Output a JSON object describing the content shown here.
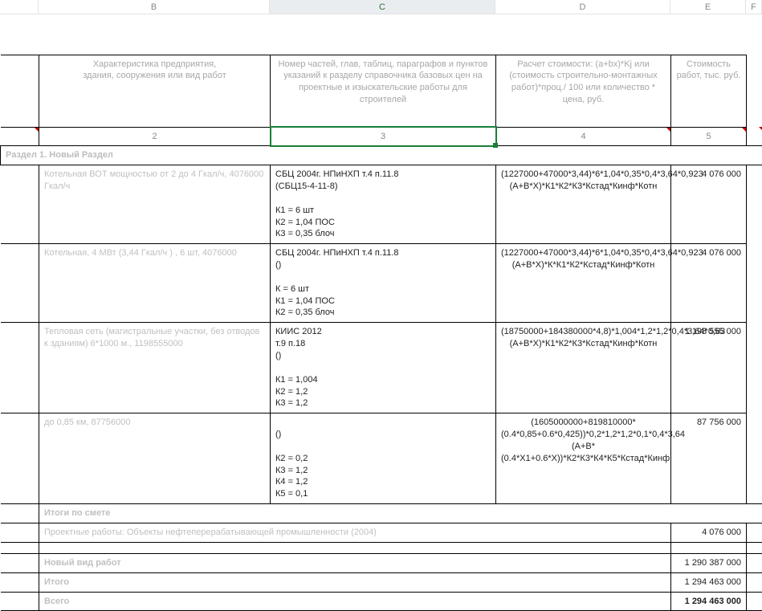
{
  "columns": {
    "A": "",
    "B": "B",
    "C": "C",
    "D": "D",
    "E": "E",
    "F": "F"
  },
  "header": {
    "B": "Характеристика предприятия,\nздания, сооружения или вид работ",
    "C": "Номер частей, глав, таблиц, параграфов и пунктов указаний к разделу справочника базовых цен на проектные и изыскательские работы для строителей",
    "D": "Расчет стоимости: (a+bx)*Kj или (стоимость строительно-монтажных работ)*проц./ 100 или количество * цена, руб.",
    "E": "Стоимость работ,   тыс. руб."
  },
  "numrow": {
    "B": "2",
    "C": "3",
    "D": "4",
    "E": "5"
  },
  "section": "Раздел 1. Новый Раздел",
  "rows": [
    {
      "B": "Котельная ВОТ мощностью от 2 до 4 Гкал/ч, 4076000 Гкал/ч",
      "C": "СБЦ 2004г. НПиНХП т.4 п.11.8\n(СБЦ15-4-11-8)\n\nК1 = 6 шт\nК2 = 1,04 ПОС\nК3 = 0,35 блоч",
      "D": "(1227000+47000*3,44)*6*1,04*0,35*0,4*3,64*0,923\n(A+B*X)*К1*К2*К3*Кстад*Кинф*Котн",
      "E": "4 076 000"
    },
    {
      "B": "Котельная, 4 МВт (3,44 Гкал/ч ) , 6 шт, 4076000",
      "C": "СБЦ 2004г. НПиНХП т.4 п.11.8\n()\n\nК = 6 шт\nК1 = 1,04 ПОС\nК2 = 0,35 блоч",
      "D": "(1227000+47000*3,44)*6*1,04*0,35*0,4*3,64*0,923\n(A+B*X)*К*К1*К2*Кстад*Кинф*Котн",
      "E": "4 076 000"
    },
    {
      "B": "Тепловая сеть (магистральные участки, без отводов к зданиям) 6*1000 м., 1198555000",
      "C": "КИИС 2012\nт.9 п.18\n()\n\nК1 = 1,004\nК2 = 1,2\nК3 = 1,2",
      "D": "(18750000+184380000*4,8)*1,004*1,2*1,2*0,4*3,64*0,63\n(A+B*X)*К1*К2*К3*Кстад*Кинф*Котн",
      "E": "1 198 555 000"
    },
    {
      "B": "до 0,85 км, 87756000",
      "C": "\n()\n\nК2 = 0,2\nК3 = 1,2\nК4 = 1,2\nК5 = 0,1",
      "D": "(1605000000+819810000*(0.4*0,85+0.6*0,425))*0,2*1,2*1,2*0,1*0,4*3,64\n(A+B*(0.4*X1+0.6*X))*К2*К3*К4*К5*Кстад*Кинф",
      "E": "87 756 000"
    }
  ],
  "totals": {
    "heading": "Итоги по смете",
    "line1_label": "Проектные работы: Объекты нефтеперерабатывающей промышленности (2004)",
    "line1_val": "4 076 000",
    "line2_label": "Новый вид работ",
    "line2_val": "1 290 387 000",
    "line3_label": "Итого",
    "line3_val": "1 294 463 000",
    "line4_label": "Всего",
    "line4_val": "1 294 463 000"
  }
}
